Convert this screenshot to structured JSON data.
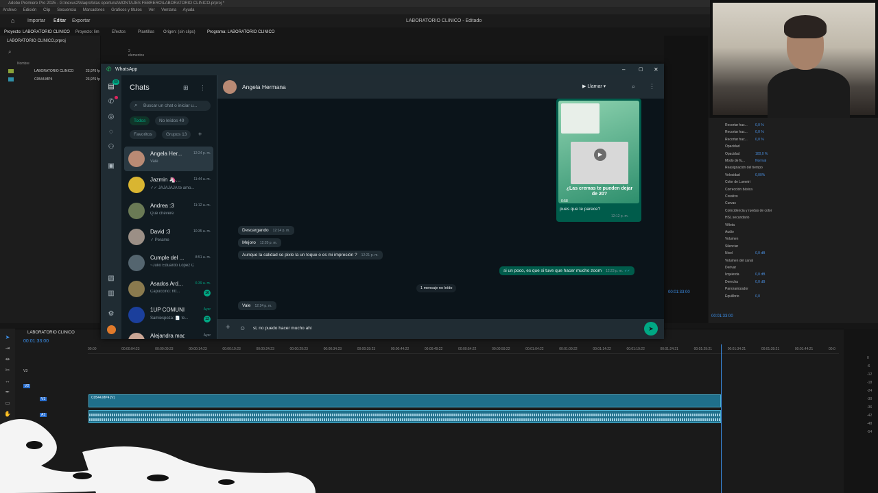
{
  "premiere": {
    "title": "Adobe Premiere Pro 2025 - G:\\nexus2\\Maqro\\Mas oportuna\\MONTAJES FEBRERO\\LABORATORIO CLINICO.prproj *",
    "menu": [
      "Archivo",
      "Edición",
      "Clip",
      "Secuencia",
      "Marcadores",
      "Gráficos y títulos",
      "Ver",
      "Ventana",
      "Ayuda"
    ],
    "workspace": {
      "importar": "Importar",
      "editar": "Editar",
      "exportar": "Exportar",
      "doc_title": "LABORATORIO CLINICO - Editado"
    },
    "panel_tabs": {
      "project": "Proyecto: LABORATORIO CLINICO",
      "bin": "Proyecto: lim",
      "effects": "Efectos",
      "templates": "Plantillas",
      "source": "Origen: (sin clips)",
      "program": "Programa: LABORATORIO CLINICO"
    },
    "project": {
      "file": "LABORATORIO CLINICO.prproj",
      "count": "2 elementos",
      "col_name": "Nombre",
      "col_rate": "Velocidad de fotogr. Inicio de medio",
      "items": [
        {
          "name": "LABORATORIO CLINICO",
          "rate": "23,976 fp"
        },
        {
          "name": "C0544.MP4",
          "rate": "23,976 fp"
        }
      ]
    },
    "program_timecode": "00:01:33:00",
    "effect_controls": {
      "rows": [
        {
          "label": "Recortar hac...",
          "value": "0,0 %"
        },
        {
          "label": "Recortar hac...",
          "value": "0,0 %"
        },
        {
          "label": "Recortar hac...",
          "value": "0,0 %"
        },
        {
          "label": "Opacidad",
          "value": ""
        },
        {
          "label": "Opacidad",
          "value": "100,0 %"
        },
        {
          "label": "Modo de fu...",
          "value": "Normal"
        },
        {
          "label": "Reasignación del tiempo",
          "value": ""
        },
        {
          "label": "Velocidad",
          "value": "0,00%"
        },
        {
          "label": "Color de Lumetri",
          "value": ""
        },
        {
          "label": "Corrección básica",
          "value": ""
        },
        {
          "label": "Creativo",
          "value": ""
        },
        {
          "label": "Curvas",
          "value": ""
        },
        {
          "label": "Coincidencia y ruedas de color",
          "value": ""
        },
        {
          "label": "HSL secundario",
          "value": ""
        },
        {
          "label": "Viñeta",
          "value": ""
        },
        {
          "label": "Audio",
          "value": ""
        },
        {
          "label": "Volumen",
          "value": ""
        },
        {
          "label": "Silenciar",
          "value": ""
        },
        {
          "label": "Nivel",
          "value": "0,0 dB"
        },
        {
          "label": "Volumen del canal",
          "value": ""
        },
        {
          "label": "Derivar",
          "value": ""
        },
        {
          "label": "Izquierda",
          "value": "0,0 dB"
        },
        {
          "label": "Derecha",
          "value": "0,0 dB"
        },
        {
          "label": "Panoramizador",
          "value": ""
        },
        {
          "label": "Equilibrio",
          "value": "0,0"
        }
      ],
      "timecode": "00:01:33:00"
    },
    "timeline": {
      "sequence_tab": "LABORATORIO CLINICO",
      "timecode": "00:01:33:00",
      "ruler": [
        "00:00",
        "00:00:04:23",
        "00:00:09:23",
        "00:00:14:23",
        "00:00:19:23",
        "00:00:24:23",
        "00:00:29:23",
        "00:00:34:23",
        "00:00:39:23",
        "00:00:44:22",
        "00:00:49:22",
        "00:00:54:22",
        "00:00:59:22",
        "00:01:04:22",
        "00:01:09:22",
        "00:01:14:22",
        "00:01:19:22",
        "00:01:24:21",
        "00:01:29:21",
        "00:01:34:21",
        "00:01:39:21",
        "00:01:44:21",
        "00:0"
      ],
      "tracks": [
        "V3",
        "V2",
        "V1",
        "A1"
      ],
      "video_clip": "C0544.MP4 [V]",
      "meter_labels": [
        "0",
        "-6",
        "-12",
        "-18",
        "-24",
        "-30",
        "-36",
        "-42",
        "-48",
        "-54"
      ]
    }
  },
  "whatsapp": {
    "app_name": "WhatsApp",
    "rail_badge": "60",
    "list": {
      "title": "Chats",
      "search_placeholder": "Buscar un chat o iniciar u...",
      "filters": {
        "all": "Todos",
        "unread": "No leídos 49",
        "favorites": "Favoritos",
        "groups": "Grupos 13"
      },
      "chats": [
        {
          "name": "Angela Her...",
          "time": "12:24 p. m.",
          "preview": "Vale",
          "color": "#b98a74"
        },
        {
          "name": "Jazmin 🦄...",
          "time": "11:44 a. m.",
          "preview": "✓✓ JAJAJAJA te amo...",
          "color": "#d9b531"
        },
        {
          "name": "Andrea :3",
          "time": "11:12 a. m.",
          "preview": "Qué chévere",
          "color": "#6a7a55"
        },
        {
          "name": "David :3",
          "time": "10:35 a. m.",
          "preview": "✓ Perame",
          "color": "#9b8f86"
        },
        {
          "name": "Cumple del ...",
          "time": "8:51 a. m.",
          "preview": "~Julio Eduardo López C",
          "color": "#54656f"
        },
        {
          "name": "Asados Ard...",
          "time": "6:39 a. m.",
          "preview": "Capuccino: htt...",
          "color": "#8a7a4e",
          "unread": "16",
          "green": true
        },
        {
          "name": "1UP COMUNIC...",
          "time": "Ayer",
          "preview": "Samiespoza: 📄 te...",
          "color": "#1b3f9c",
          "unread": "12",
          "green": true
        },
        {
          "name": "Alejandra maqroll",
          "time": "Ayer",
          "preview": "",
          "color": "#c8a595"
        }
      ]
    },
    "chat": {
      "contact": "Angela Hermana",
      "call_label": "Llamar",
      "image_caption": "¿Las cremas te pueden dejar de 20?",
      "image_duration": "0:58",
      "image_text": "pues que te parece?",
      "image_time": "12:12 p. m.",
      "messages_in": [
        {
          "text": "Descargando",
          "time": "12:14 p. m."
        },
        {
          "text": "Mejoro",
          "time": "12:20 p. m."
        },
        {
          "text": "Aunque la calidad se pixle la un toque o es mi impresión ?",
          "time": "12:21 p. m."
        }
      ],
      "message_out": {
        "text": "si un poco, es que si tuve que hacer mucho zoom",
        "time": "12:23 p. m."
      },
      "unread_divider": "1 mensaje no leído",
      "last_in": {
        "text": "Vale",
        "time": "12:24 p. m."
      },
      "composer_value": "si, no puedo hacer mucho ahi"
    },
    "colors": {
      "accent": "#00a884",
      "bubble_out": "#005c4b",
      "bubble_in": "#202c33"
    }
  }
}
